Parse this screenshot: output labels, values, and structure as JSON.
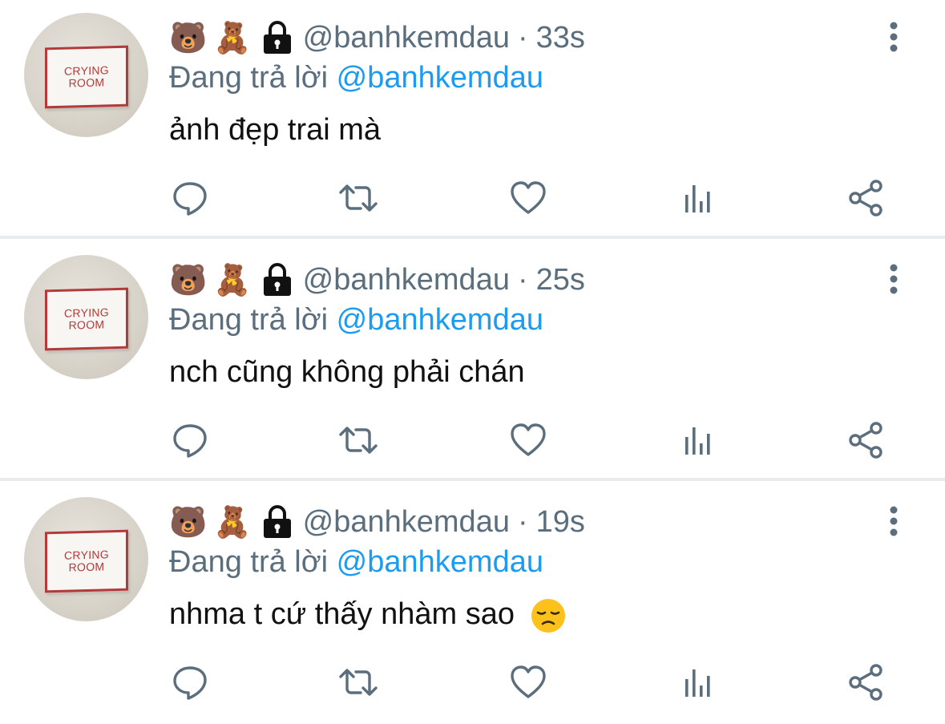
{
  "tweets": [
    {
      "emoji_1": "🐻",
      "emoji_2": "🧸",
      "handle": "@banhkemdau",
      "separator": "·",
      "time": "33s",
      "replying_prefix": "Đang trả lời",
      "replying_to": "@banhkemdau",
      "text": "ảnh đẹp trai mà",
      "avatar_text_line1": "CRYING",
      "avatar_text_line2": "ROOM"
    },
    {
      "emoji_1": "🐻",
      "emoji_2": "🧸",
      "handle": "@banhkemdau",
      "separator": "·",
      "time": "25s",
      "replying_prefix": "Đang trả lời",
      "replying_to": "@banhkemdau",
      "text": "nch cũng không phải chán",
      "avatar_text_line1": "CRYING",
      "avatar_text_line2": "ROOM"
    },
    {
      "emoji_1": "🐻",
      "emoji_2": "🧸",
      "handle": "@banhkemdau",
      "separator": "·",
      "time": "19s",
      "replying_prefix": "Đang trả lời",
      "replying_to": "@banhkemdau",
      "text": "nhma t cứ thấy nhàm sao",
      "trailing_emoji": "disappointed-face",
      "avatar_text_line1": "CRYING",
      "avatar_text_line2": "ROOM"
    }
  ],
  "icons": {
    "lock": "lock-icon",
    "more": "more-vertical-icon",
    "reply": "comment-icon",
    "retweet": "retweet-icon",
    "like": "heart-icon",
    "views": "analytics-icon",
    "share": "share-icon"
  },
  "colors": {
    "secondary_text": "#5b6e7d",
    "mention": "#1d9bf0",
    "primary_text": "#111111",
    "divider": "#e9ecef",
    "icon_gray": "#5b6e7d"
  }
}
